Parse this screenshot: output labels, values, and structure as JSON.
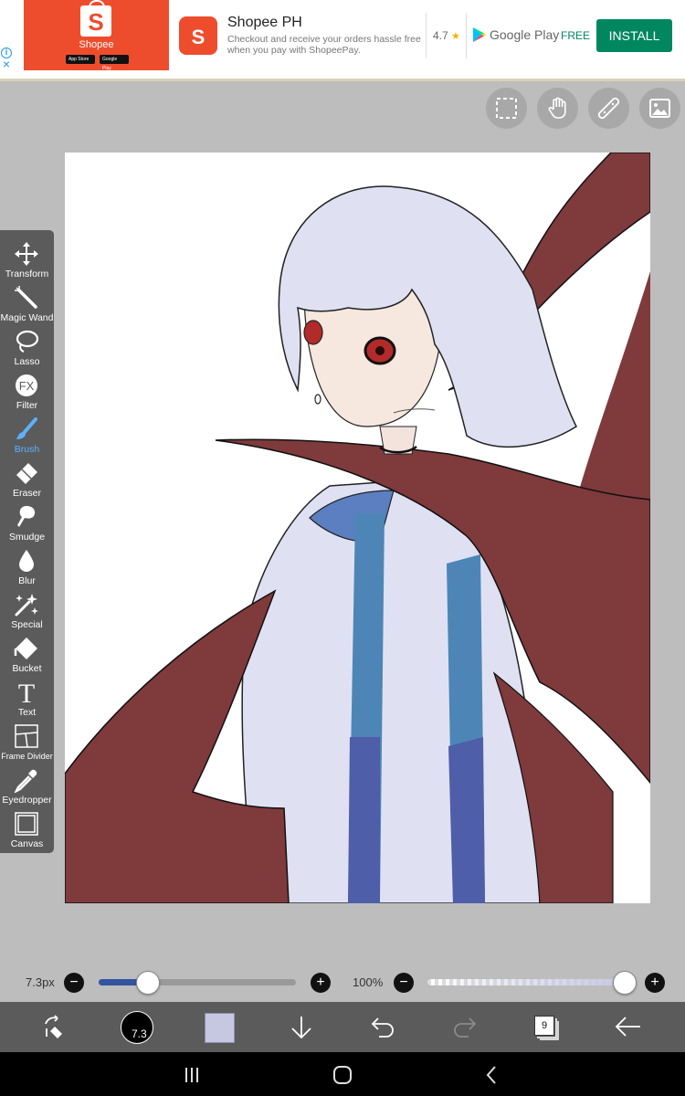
{
  "ad": {
    "brand_name": "Shopee",
    "bag_letter": "S",
    "app_store_badge": "App Store",
    "google_play_badge": "Google Play",
    "title": "Shopee PH",
    "description": "Checkout and receive your orders hassle free when you pay with ShopeePay.",
    "rating": "4.7",
    "rating_star": "★",
    "store": "Google Play",
    "price": "FREE",
    "install_label": "INSTALL",
    "info_symbol": "i",
    "close_symbol": "×"
  },
  "top_tools": [
    {
      "icon": "selection-icon"
    },
    {
      "icon": "hand-icon"
    },
    {
      "icon": "ruler-icon"
    },
    {
      "icon": "image-icon"
    }
  ],
  "toolbar": {
    "tools": [
      {
        "label": "Transform",
        "icon": "transform-icon"
      },
      {
        "label": "Magic Wand",
        "icon": "magic-wand-icon"
      },
      {
        "label": "Lasso",
        "icon": "lasso-icon"
      },
      {
        "label": "Filter",
        "icon": "fx-icon",
        "glyph": "FX"
      },
      {
        "label": "Brush",
        "icon": "brush-icon",
        "active": true
      },
      {
        "label": "Eraser",
        "icon": "eraser-icon"
      },
      {
        "label": "Smudge",
        "icon": "smudge-icon"
      },
      {
        "label": "Blur",
        "icon": "blur-drop-icon"
      },
      {
        "label": "Special",
        "icon": "sparkle-icon"
      },
      {
        "label": "Bucket",
        "icon": "bucket-icon"
      },
      {
        "label": "Text",
        "icon": "text-icon",
        "glyph": "T"
      },
      {
        "label": "Frame Divider",
        "icon": "frame-divider-icon"
      },
      {
        "label": "Eyedropper",
        "icon": "eyedropper-icon"
      },
      {
        "label": "Canvas",
        "icon": "canvas-icon"
      }
    ]
  },
  "brush_size": {
    "label": "7.3px",
    "minus": "−",
    "plus": "+",
    "value_fraction": 0.25
  },
  "opacity": {
    "label": "100%",
    "minus": "−",
    "plus": "+",
    "value_percent": 100
  },
  "bottom_bar": {
    "brush_size_badge": "7.3",
    "current_color": "#c6c8e2",
    "layer_count": "9"
  },
  "colors": {
    "accent": "#5ab2ff",
    "toolbar_bg": "#5b5b5b",
    "cape_red": "#7f3a3c",
    "hair_lavender": "#dfe1f3",
    "ad_orange": "#ee4d2d",
    "install_green": "#01875f"
  }
}
